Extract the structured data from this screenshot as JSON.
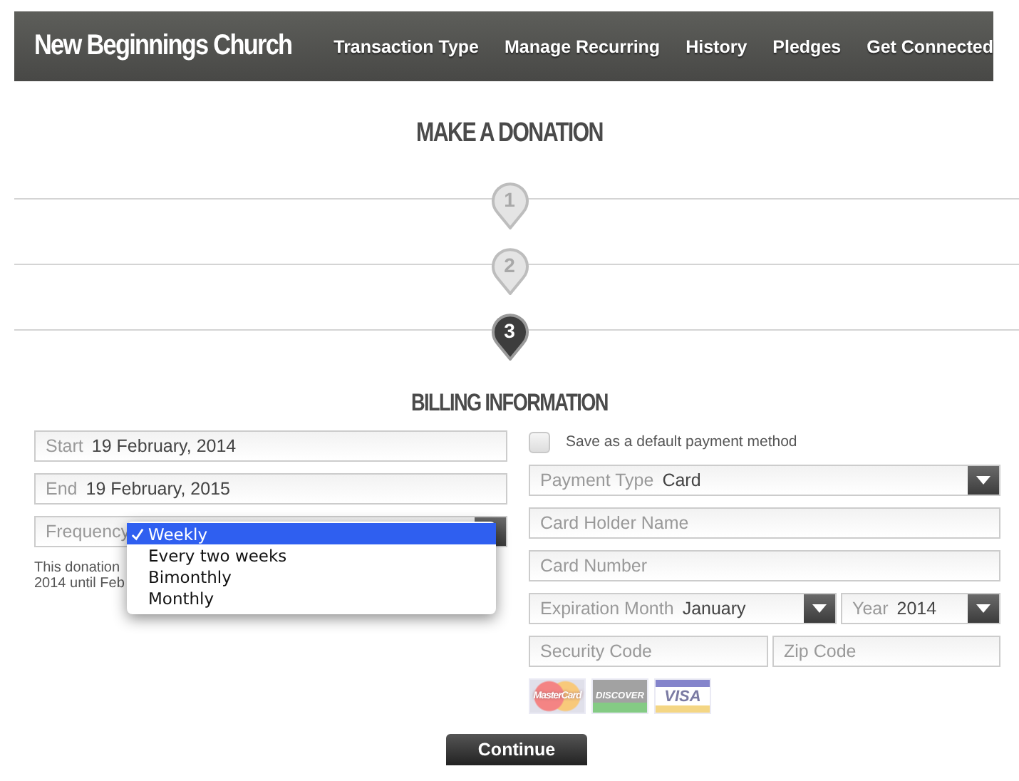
{
  "header": {
    "title": "New Beginnings Church",
    "nav": [
      {
        "label": "Transaction Type"
      },
      {
        "label": "Manage Recurring"
      },
      {
        "label": "History"
      },
      {
        "label": "Pledges"
      },
      {
        "label": "Get Connected"
      }
    ]
  },
  "page_title": "MAKE A DONATION",
  "steps": [
    {
      "number": "1",
      "selected": false
    },
    {
      "number": "2",
      "selected": false
    },
    {
      "number": "3",
      "selected": true
    }
  ],
  "section_title": "BILLING INFORMATION",
  "left_fields": [
    {
      "kind": "text",
      "label": "Start",
      "value": "19 February, 2014"
    },
    {
      "kind": "text",
      "label": "End",
      "value": "19 February, 2015"
    },
    {
      "kind": "select",
      "label": "Frequency"
    }
  ],
  "frequency_menu": [
    {
      "label": "Weekly",
      "selected": true
    },
    {
      "label": "Every two weeks",
      "selected": false
    },
    {
      "label": "Bimonthly",
      "selected": false
    },
    {
      "label": "Monthly",
      "selected": false
    }
  ],
  "note_lines": [
    "This donation",
    "2014 until Feb"
  ],
  "save_default": {
    "label": "Save as a default payment method",
    "checked": false
  },
  "payment_type": {
    "label": "Payment Type",
    "value": "Card"
  },
  "card_holder": {
    "placeholder": "Card Holder Name"
  },
  "card_number": {
    "placeholder": "Card Number"
  },
  "expiration_month": {
    "label": "Expiration Month",
    "value": "January"
  },
  "expiration_year": {
    "label": "Year",
    "value": "2014"
  },
  "security_code": {
    "placeholder": "Security Code"
  },
  "zip_code": {
    "placeholder": "Zip Code"
  },
  "card_logos": [
    {
      "kind": "mastercard",
      "label": "MasterCard"
    },
    {
      "kind": "discover",
      "label": "DISCOVER"
    },
    {
      "kind": "visa",
      "label": "VISA"
    }
  ],
  "continue_button": "Continue"
}
